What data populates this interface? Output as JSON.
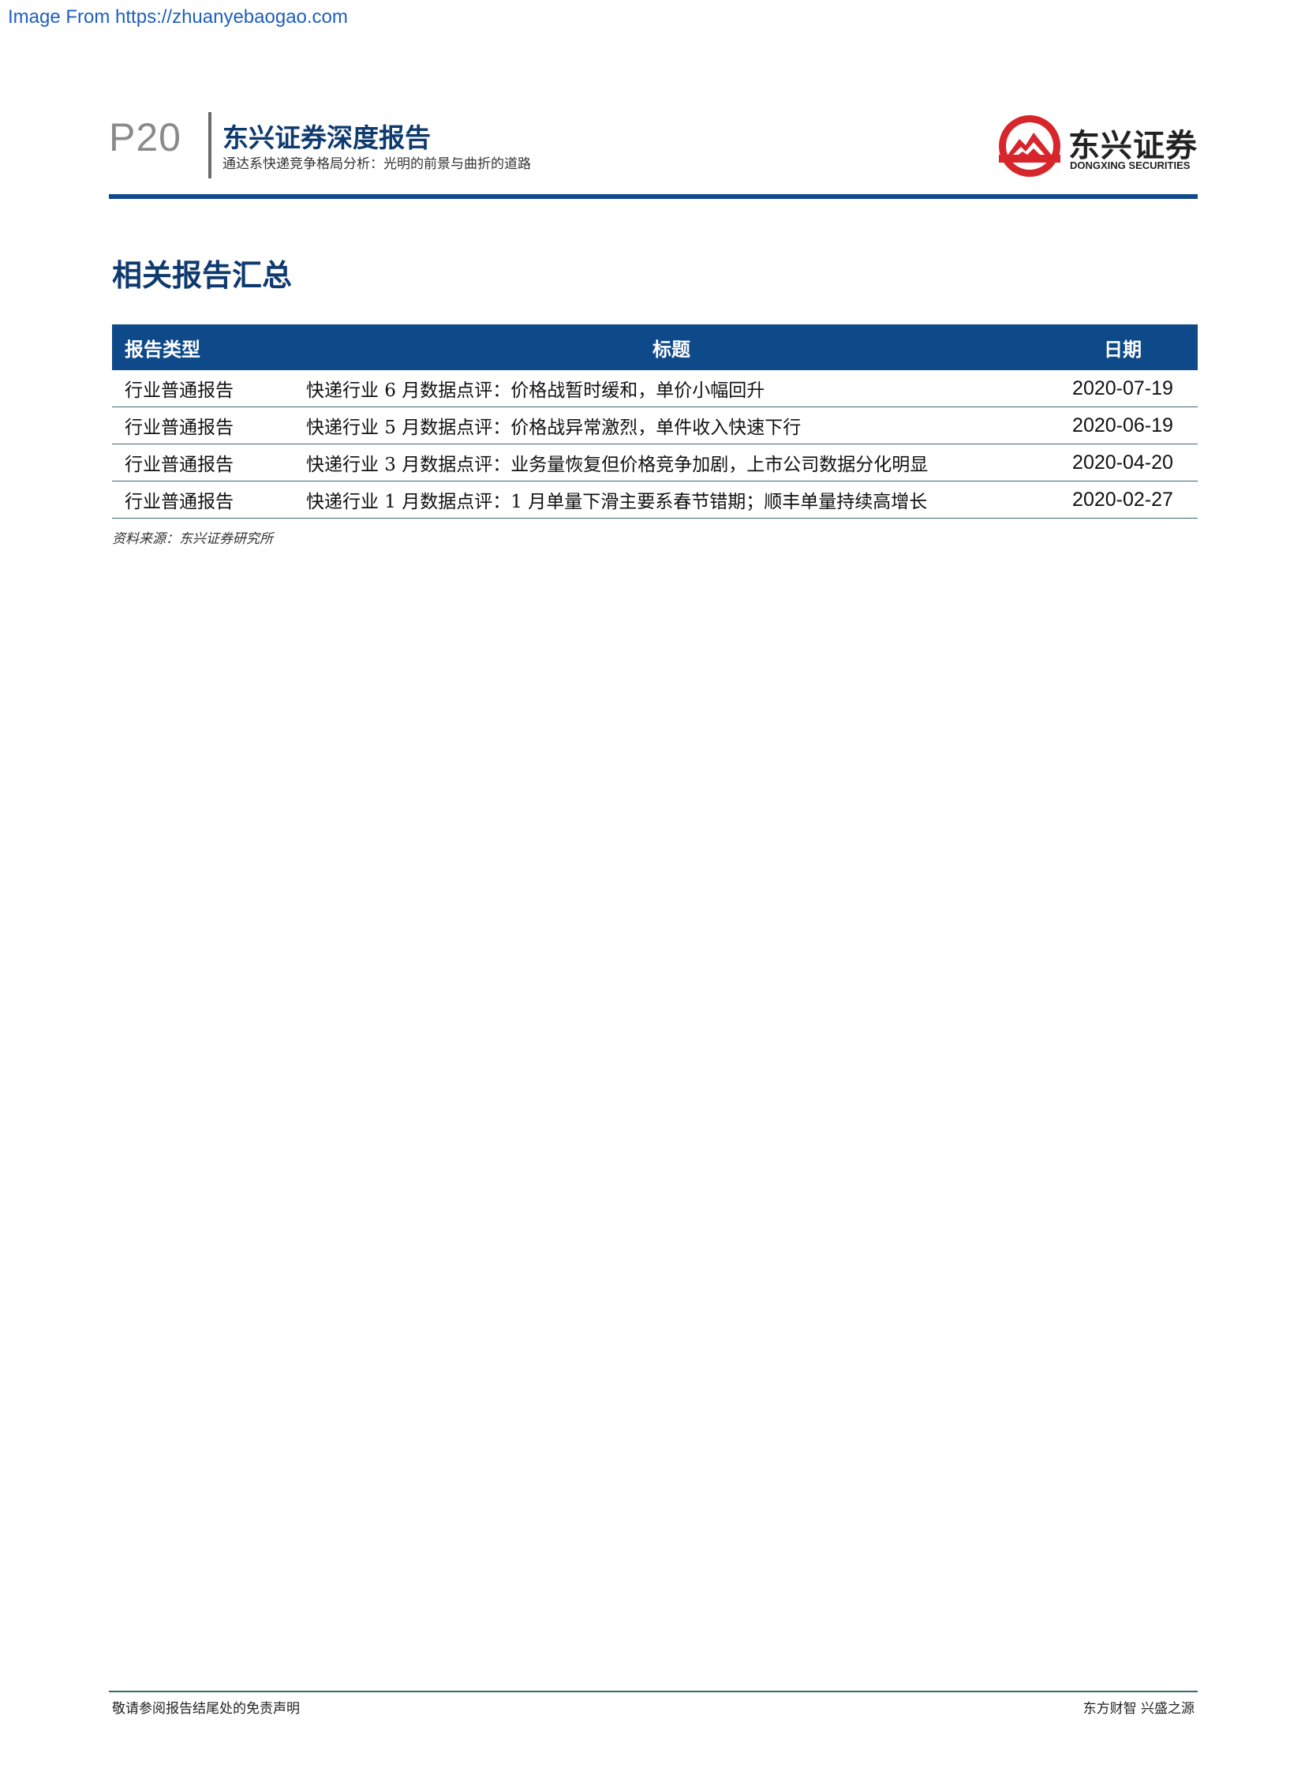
{
  "source_link": "Image From https://zhuanyebaogao.com",
  "header": {
    "page_number": "P20",
    "title": "东兴证券深度报告",
    "subtitle": "通达系快递竞争格局分析：光明的前景与曲折的道路",
    "logo": {
      "name_cn": "东兴证券",
      "name_en": "DONGXING SECURITIES",
      "icon": "dongxing-logo-icon",
      "colors": {
        "red": "#d7262b",
        "white": "#ffffff"
      }
    }
  },
  "section": {
    "title": "相关报告汇总"
  },
  "table": {
    "columns": [
      "报告类型",
      "标题",
      "日期"
    ],
    "rows": [
      {
        "type": "行业普通报告",
        "title": "快递行业 6 月数据点评：价格战暂时缓和，单价小幅回升",
        "date": "2020-07-19"
      },
      {
        "type": "行业普通报告",
        "title": "快递行业 5 月数据点评：价格战异常激烈，单件收入快速下行",
        "date": "2020-06-19"
      },
      {
        "type": "行业普通报告",
        "title": "快递行业 3 月数据点评：业务量恢复但价格竞争加剧，上市公司数据分化明显",
        "date": "2020-04-20"
      },
      {
        "type": "行业普通报告",
        "title": "快递行业 1 月数据点评：1 月单量下滑主要系春节错期；顺丰单量持续高增长",
        "date": "2020-02-27"
      }
    ],
    "source": "资料来源：东兴证券研究所"
  },
  "footer": {
    "left": "敬请参阅报告结尾处的免责声明",
    "right": "东方财智  兴盛之源"
  },
  "colors": {
    "brand_blue": "#0e4a8a",
    "heading_blue": "#0e3a6e",
    "rule_teal": "#3c6a6a"
  }
}
